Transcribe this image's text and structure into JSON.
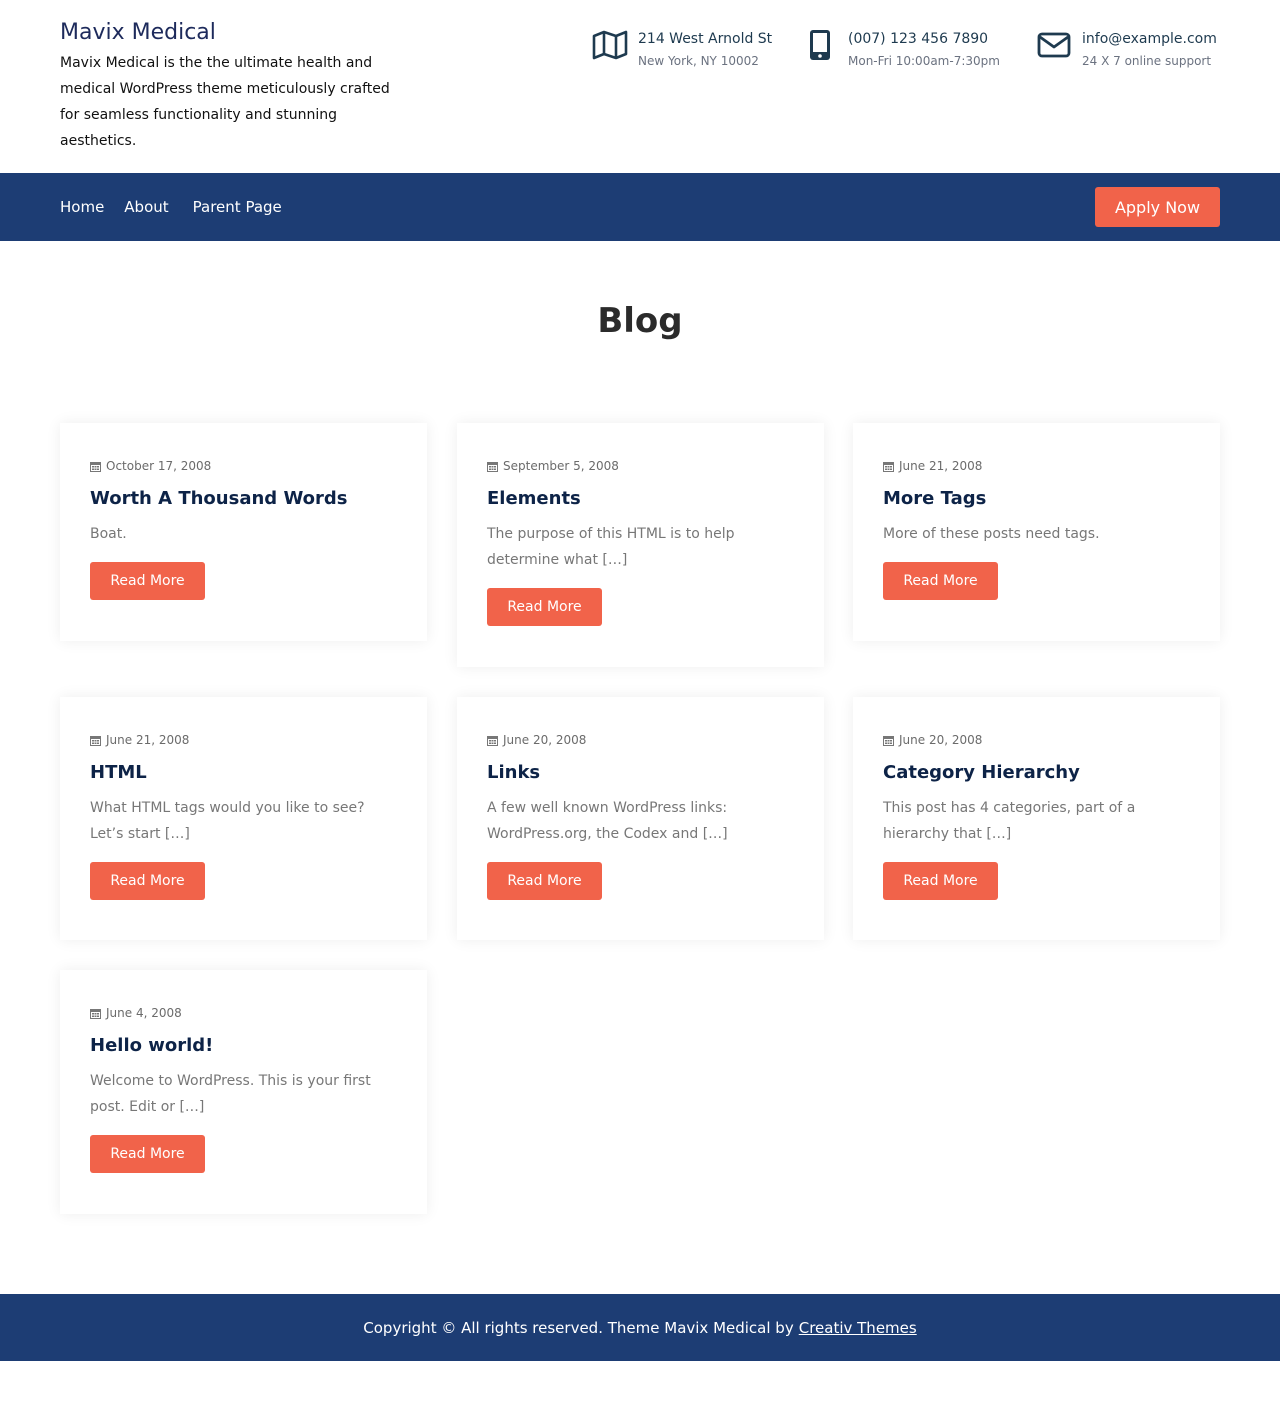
{
  "brand": {
    "title": "Mavix Medical",
    "tagline": "Mavix Medical is the the ultimate health and medical WordPress theme meticulously crafted for seamless functionality and stunning aesthetics."
  },
  "contacts": {
    "address": {
      "icon": "map-icon",
      "line1": "214 West Arnold St",
      "line2": "New York, NY 10002"
    },
    "phone": {
      "icon": "mobile-phone-icon",
      "line1": "(007) 123 456 7890",
      "line2": "Mon-Fri 10:00am-7:30pm"
    },
    "email": {
      "icon": "envelope-icon",
      "line1": "info@example.com",
      "line2": "24 X 7 online support"
    }
  },
  "nav": {
    "items": [
      "Home",
      "About",
      "Parent Page"
    ],
    "cta": "Apply Now"
  },
  "page": {
    "title": "Blog"
  },
  "posts": [
    {
      "date": "October 17, 2008",
      "title": "Worth A Thousand Words",
      "excerpt": "Boat.",
      "button": "Read More"
    },
    {
      "date": "September 5, 2008",
      "title": "Elements",
      "excerpt": "The purpose of this HTML is to help determine what […]",
      "button": "Read More"
    },
    {
      "date": "June 21, 2008",
      "title": "More Tags",
      "excerpt": "More of these posts need tags.",
      "button": "Read More"
    },
    {
      "date": "June 21, 2008",
      "title": "HTML",
      "excerpt": "What HTML tags would you like to see? Let’s start […]",
      "button": "Read More"
    },
    {
      "date": "June 20, 2008",
      "title": "Links",
      "excerpt": "A few well known WordPress links: WordPress.org, the Codex and […]",
      "button": "Read More"
    },
    {
      "date": "June 20, 2008",
      "title": "Category Hierarchy",
      "excerpt": "This post has 4 categories, part of a hierarchy that […]",
      "button": "Read More"
    },
    {
      "date": "June 4, 2008",
      "title": "Hello world!",
      "excerpt": "Welcome to WordPress. This is your first post. Edit or […]",
      "button": "Read More"
    }
  ],
  "footer": {
    "text": "Copyright © All rights reserved. Theme Mavix Medical by",
    "link": "Creativ Themes"
  },
  "colors": {
    "navy": "#1d3d74",
    "accent": "#f1634a",
    "title": "#0d2347"
  }
}
